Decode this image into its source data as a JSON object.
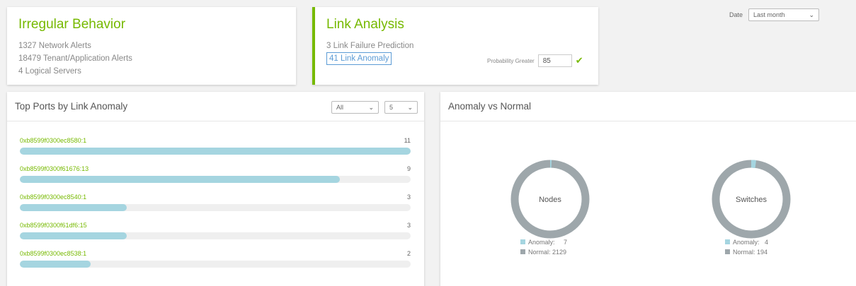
{
  "irregular": {
    "title": "Irregular Behavior",
    "lines": [
      "1327 Network Alerts",
      "18479 Tenant/Application Alerts",
      "4 Logical Servers"
    ]
  },
  "link_analysis": {
    "title": "Link Analysis",
    "failure_prediction": "3 Link Failure Prediction",
    "link_anomaly": "41 Link Anomaly",
    "probability_label": "Probability Greater",
    "probability_value": "85"
  },
  "date": {
    "label": "Date",
    "selected": "Last month"
  },
  "top_ports": {
    "title": "Top Ports by Link Anomaly",
    "filter_selected": "All",
    "count_selected": "5",
    "max": 11,
    "ports": [
      {
        "label": "0xb8599f0300ec8580:1",
        "value": 11
      },
      {
        "label": "0xb8599f0300f61676:13",
        "value": 9
      },
      {
        "label": "0xb8599f0300ec8540:1",
        "value": 3
      },
      {
        "label": "0xb8599f0300f61df6:15",
        "value": 3
      },
      {
        "label": "0xb8599f0300ec8538:1",
        "value": 2
      }
    ]
  },
  "anomaly_vs_normal": {
    "title": "Anomaly vs Normal",
    "nodes": {
      "center": "Nodes",
      "anomaly_label": "Anomaly:",
      "anomaly_value": 7,
      "normal_label": "Normal:",
      "normal_value": 2129
    },
    "switches": {
      "center": "Switches",
      "anomaly_label": "Anomaly:",
      "anomaly_value": 4,
      "normal_label": "Normal:",
      "normal_value": 194
    }
  },
  "colors": {
    "accent": "#76b900",
    "anomaly": "#a5d5e0",
    "normal": "#9ea7ab",
    "link_blue": "#5b9bd5"
  }
}
